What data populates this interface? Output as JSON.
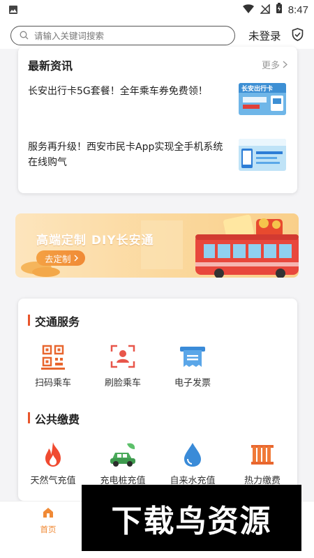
{
  "status_bar": {
    "time": "8:47",
    "icons": [
      "image-icon",
      "wifi-icon",
      "no-signal-icon",
      "battery-charging-icon"
    ]
  },
  "header": {
    "search_placeholder": "请输入关键词搜索",
    "login_label": "未登录",
    "shield_icon": "shield-check-icon"
  },
  "news": {
    "title": "最新资讯",
    "more_label": "更多",
    "items": [
      {
        "text": "长安出行卡5G套餐！全年乘车券免费领！",
        "thumb": "news-thumb-5g-card"
      },
      {
        "text": "服务再升级！西安市民卡App实现全手机系统在线购气",
        "thumb": "news-thumb-app"
      }
    ]
  },
  "banner": {
    "title": "高端定制 DIY长安通",
    "button_label": "去定制",
    "colors": {
      "bg": "#fbd99f",
      "button": "#f08a36"
    }
  },
  "transport": {
    "title": "交通服务",
    "items": [
      {
        "label": "扫码乘车",
        "icon": "qr-code-icon"
      },
      {
        "label": "刷脸乘车",
        "icon": "face-scan-icon"
      },
      {
        "label": "电子发票",
        "icon": "invoice-icon"
      }
    ]
  },
  "payments": {
    "title": "公共缴费",
    "items": [
      {
        "label": "天然气充值",
        "icon": "flame-icon"
      },
      {
        "label": "充电桩充值",
        "icon": "electric-car-icon"
      },
      {
        "label": "自来水充值",
        "icon": "water-drop-icon"
      },
      {
        "label": "热力缴费",
        "icon": "radiator-icon"
      }
    ]
  },
  "bottom_nav": {
    "home_label": "首页"
  },
  "watermark": {
    "text": "下载鸟资源"
  },
  "colors": {
    "accent": "#f08a36",
    "section_bar": "#e8562c"
  }
}
